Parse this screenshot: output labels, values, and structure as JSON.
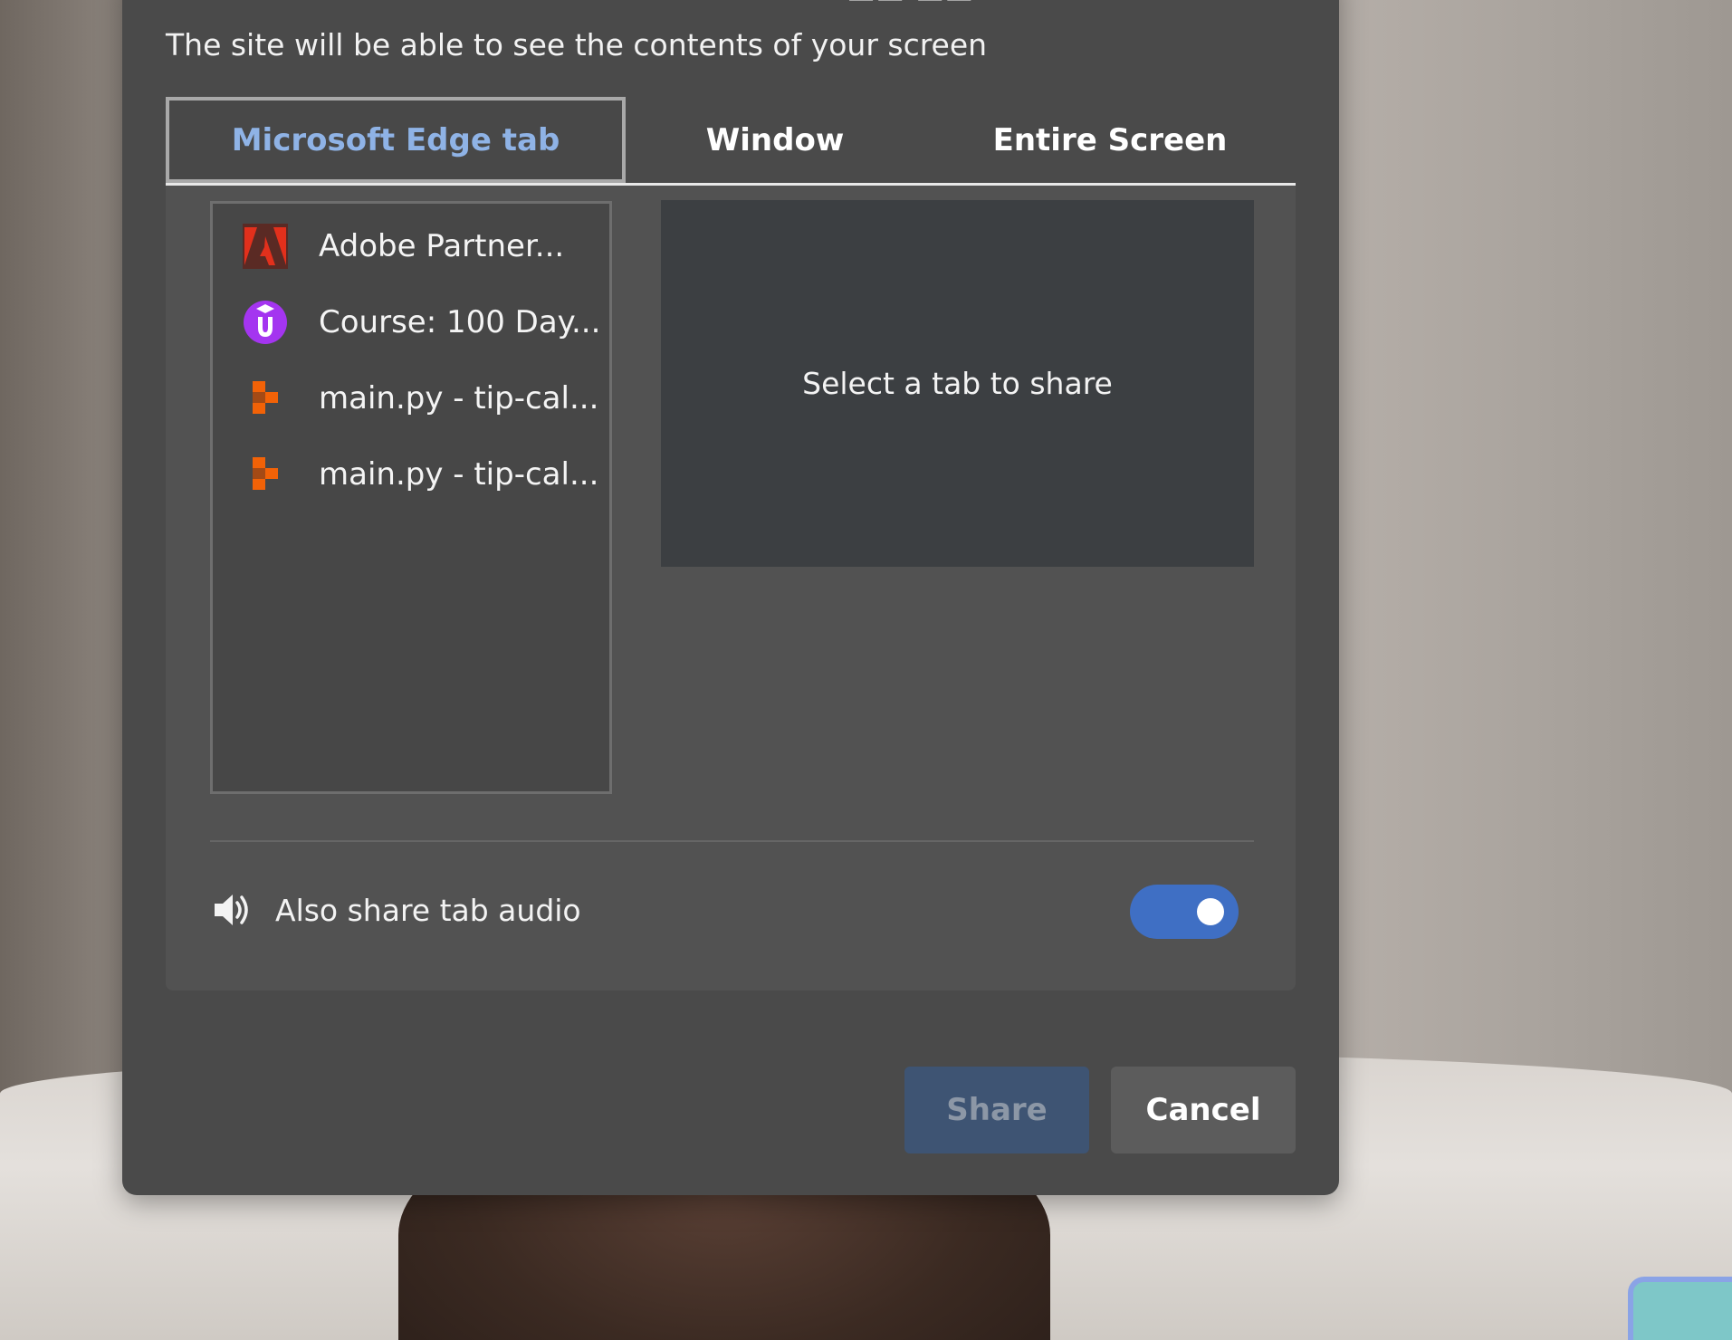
{
  "dialog": {
    "subtitle": "The site will be able to see the contents of your screen",
    "tabs": [
      {
        "label": "Microsoft Edge tab",
        "active": true
      },
      {
        "label": "Window",
        "active": false
      },
      {
        "label": "Entire Screen",
        "active": false
      }
    ]
  },
  "tab_list": {
    "items": [
      {
        "label": "Adobe Partner...",
        "icon": "adobe-icon"
      },
      {
        "label": "Course: 100 Day...",
        "icon": "udemy-icon"
      },
      {
        "label": "main.py - tip-cal...",
        "icon": "replit-icon"
      },
      {
        "label": "main.py - tip-cal...",
        "icon": "replit-icon"
      }
    ]
  },
  "preview": {
    "placeholder": "Select a tab to share"
  },
  "audio": {
    "label": "Also share tab audio",
    "enabled": true,
    "icon": "speaker-icon"
  },
  "buttons": {
    "share": "Share",
    "cancel": "Cancel"
  },
  "colors": {
    "accent": "#3f6fc4",
    "active_tab_text": "#8fb3e6",
    "dialog_bg": "#4a4a4a"
  }
}
